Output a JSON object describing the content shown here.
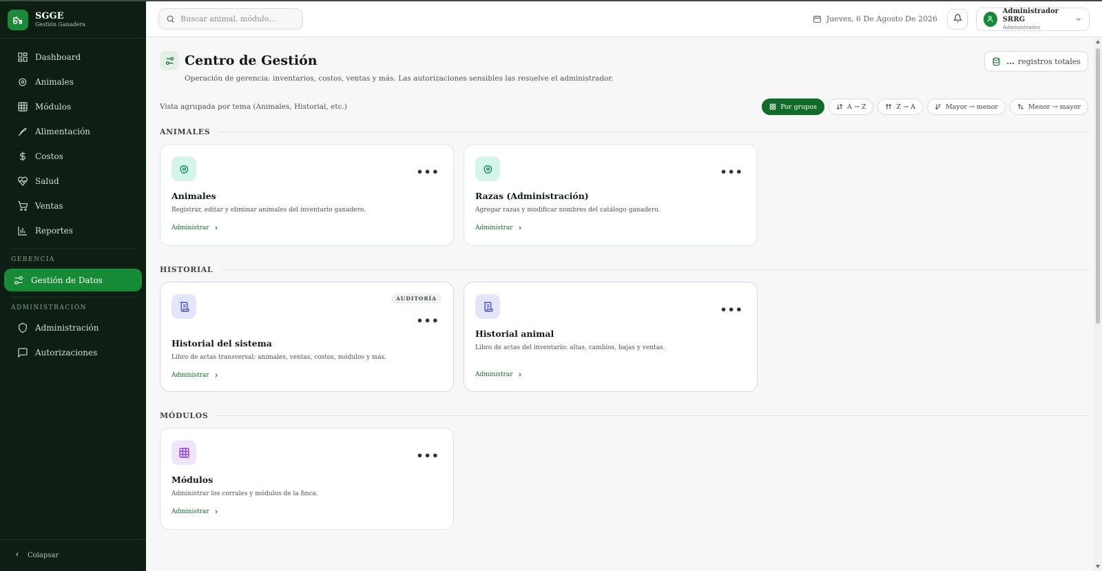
{
  "brand": {
    "name": "SGGE",
    "subtitle": "Gestión Ganadera"
  },
  "sidebar": {
    "items": [
      {
        "label": "Dashboard",
        "icon": "dashboard-icon"
      },
      {
        "label": "Animales",
        "icon": "cow-icon"
      },
      {
        "label": "Módulos",
        "icon": "grid-icon"
      },
      {
        "label": "Alimentación",
        "icon": "wheat-icon"
      },
      {
        "label": "Costos",
        "icon": "dollar-icon"
      },
      {
        "label": "Salud",
        "icon": "heart-pulse-icon"
      },
      {
        "label": "Ventas",
        "icon": "cart-icon"
      },
      {
        "label": "Reportes",
        "icon": "bar-chart-icon"
      }
    ],
    "section_gerencia": "GERENCIA",
    "gerencia_item": "Gestión de Datos",
    "section_admin": "ADMINISTRACIÓN",
    "admin_items": [
      {
        "label": "Administración",
        "icon": "shield-icon"
      },
      {
        "label": "Autorizaciones",
        "icon": "message-icon"
      }
    ],
    "collapse_label": "Colapsar"
  },
  "topbar": {
    "search_placeholder": "Buscar animal, módulo...",
    "date": "Jueves, 6 De Agosto De 2026",
    "user_name": "Administrador SRRG",
    "user_role": "Administrador"
  },
  "page": {
    "title": "Centro de Gestión",
    "description": "Operación de gerencia: inventarios, costos, ventas y más. Las autorizaciones sensibles las resuelve el administrador.",
    "records_count": "...",
    "records_label": "registros totales",
    "view_text": "Vista agrupada por tema (Animales, Historial, etc.)",
    "sort_buttons": [
      "Por grupos",
      "A → Z",
      "Z → A",
      "Mayor → menor",
      "Menor → mayor"
    ]
  },
  "groups": [
    {
      "title": "ANIMALES",
      "cards": [
        {
          "title": "Animales",
          "desc": "Registrar, editar y eliminar animales del inventario ganadero.",
          "link": "Administrar"
        },
        {
          "title": "Razas (Administración)",
          "desc": "Agregar razas y modificar nombres del catálogo ganadero.",
          "link": "Administrar"
        }
      ]
    },
    {
      "title": "HISTORIAL",
      "cards": [
        {
          "title": "Historial del sistema",
          "desc": "Libro de actas transversal: animales, ventas, costos, módulos y más.",
          "link": "Administrar",
          "badge": "AUDITORÍA"
        },
        {
          "title": "Historial animal",
          "desc": "Libro de actas del inventario: altas, cambios, bajas y ventas.",
          "link": "Administrar"
        }
      ]
    },
    {
      "title": "MÓDULOS",
      "cards": [
        {
          "title": "Módulos",
          "desc": "Administrar los corrales y módulos de la finca.",
          "link": "Administrar"
        }
      ]
    }
  ],
  "colors": {
    "brand_green": "#168a35",
    "sidebar_bg": "#0c1f12",
    "link_green": "#0f6b27"
  }
}
